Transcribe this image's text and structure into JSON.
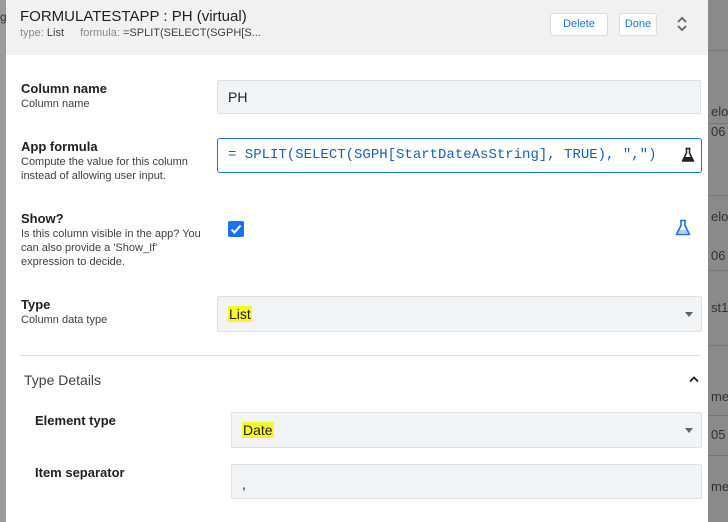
{
  "background": {
    "left_glyph": "g",
    "right_fragments": [
      "elo",
      "06",
      "elo",
      "st1",
      "me",
      "05",
      "me"
    ]
  },
  "header": {
    "title": "FORMULATESTAPP : PH (virtual)",
    "type_label": "type:",
    "type_value": "List",
    "formula_label": "formula:",
    "formula_value": "=SPLIT(SELECT(SGPH[S...",
    "delete_label": "Delete",
    "done_label": "Done",
    "expand_icon": "unfold-more-icon"
  },
  "column_name": {
    "label": "Column name",
    "help": "Column name",
    "value": "PH"
  },
  "app_formula": {
    "label": "App formula",
    "help": "Compute the value for this column instead of allowing user input.",
    "value": "= SPLIT(SELECT(SGPH[StartDateAsString], TRUE), \",\")",
    "icon": "flask-icon"
  },
  "show": {
    "label": "Show?",
    "help": "Is this column visible in the app? You can also provide a 'Show_If' expression to decide.",
    "checked": true,
    "icon": "flask-icon"
  },
  "type": {
    "label": "Type",
    "help": "Column data type",
    "value": "List"
  },
  "type_details": {
    "title": "Type Details",
    "collapse_icon": "chevron-up-icon",
    "element_type": {
      "label": "Element type",
      "value": "Date"
    },
    "item_separator": {
      "label": "Item separator",
      "value": ","
    }
  },
  "colors": {
    "accent": "#1a73e8",
    "highlight": "#f6f631",
    "header_bg": "#f1f1f1"
  }
}
